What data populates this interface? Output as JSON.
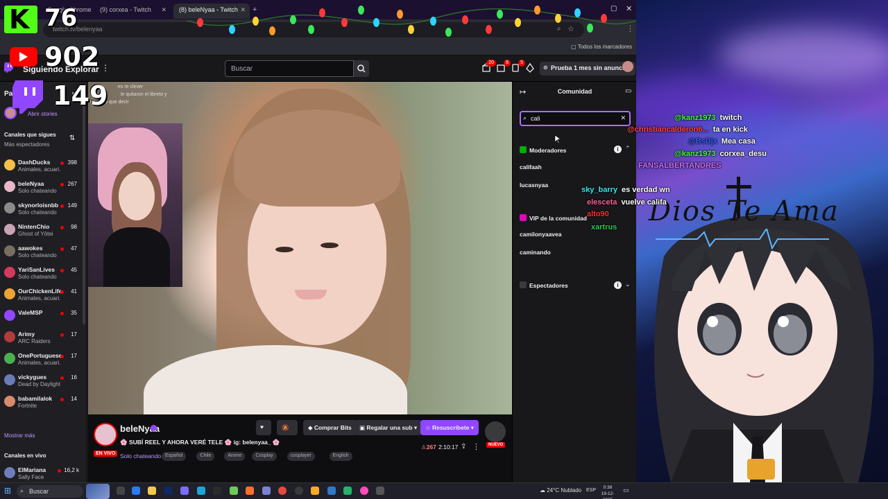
{
  "browser": {
    "tabs": [
      {
        "label": "Google Chrome"
      },
      {
        "label": "(9) corxea - Twitch"
      },
      {
        "label": "(8) beleNyaa - Twitch"
      }
    ],
    "url": "twitch.tv/belenyaa",
    "all_bookmarks": "Todos los marcadores"
  },
  "counters": {
    "kick": "76",
    "youtube": "902",
    "twitch": "149"
  },
  "nav": {
    "following": "Siguiendo",
    "explore": "Explorar",
    "search_placeholder": "Buscar",
    "notif_count_1": "20",
    "notif_count_2": "8",
    "notif_count_3": "5",
    "no_ads": "Prueba 1 mes sin anuncios"
  },
  "sidebar": {
    "header": "Para ti",
    "open_stories": "Abrir stories",
    "followed_title": "Canales que sigues",
    "followed_sub": "Más espectadores",
    "channels": [
      {
        "name": "DashDucks",
        "game": "Animales, acuari...",
        "viewers": "398",
        "color": "#f5c04a"
      },
      {
        "name": "beleNyaa",
        "game": "Solo chateando",
        "viewers": "267",
        "color": "#e8b7c8"
      },
      {
        "name": "skynorloisnbb",
        "game": "Solo chateando",
        "viewers": "149",
        "color": "#8b8b8b"
      },
      {
        "name": "NintenChio",
        "game": "Ghost of Yōtei",
        "viewers": "98",
        "color": "#c9a4b5"
      },
      {
        "name": "aawokes",
        "game": "Solo chateando",
        "viewers": "47",
        "color": "#7a6d62"
      },
      {
        "name": "YariSanLives",
        "game": "Solo chateando",
        "viewers": "45",
        "color": "#d23b5c"
      },
      {
        "name": "OurChickenLife",
        "game": "Animales, acuari...",
        "viewers": "41",
        "color": "#f0a235"
      },
      {
        "name": "ValeMSP",
        "game": "",
        "viewers": "35",
        "color": "#9147ff"
      },
      {
        "name": "Arimy",
        "game": "ARC Raiders",
        "viewers": "17",
        "color": "#b33b3b"
      },
      {
        "name": "OnePortuguese...",
        "game": "Animales, acuari...",
        "viewers": "17",
        "color": "#4caf50"
      },
      {
        "name": "vickygues",
        "game": "Dead by Daylight",
        "viewers": "16",
        "color": "#6b7bb5"
      },
      {
        "name": "babamilalok",
        "game": "Fortnite",
        "viewers": "14",
        "color": "#d88c6a"
      }
    ],
    "show_more": "Mostrar más",
    "live_title": "Canales en vivo",
    "live_channel": {
      "name": "ElMariana",
      "game": "Sally Face",
      "viewers": "16,2 k"
    }
  },
  "stream": {
    "streamer": "beleNyaa",
    "title": "🌸 SUBÍ REEL Y AHORA VERÉ TELE 🌸 ig: belenyaa_ 🌸",
    "category": "Solo chateando",
    "tags": [
      "Español",
      "Chile",
      "Anime",
      "Cosplay",
      "cosplayer",
      "English"
    ],
    "live_label": "EN VIVO",
    "viewers": "267",
    "uptime": "2:10:17",
    "buy_bits": "Comprar Bits",
    "gift_sub": "Regalar una sub",
    "resub": "Resuscríbete",
    "new_label": "NUEVO",
    "overlay_chat": [
      "es re clever",
      "le quitaron el libreto y",
      "no supo que decir"
    ]
  },
  "community": {
    "title": "Comunidad",
    "search_value": "cali",
    "moderators_label": "Moderadores",
    "moderators": [
      "califaah",
      "lucasnyaa"
    ],
    "vip_label": "VIP de la comunidad",
    "vips": [
      "camilonyaavea",
      "caminando"
    ],
    "viewers_label": "Espectadores"
  },
  "overlay_chat": [
    {
      "user": "@kanz1973",
      "msg": "twitch",
      "color": "#3cff3c"
    },
    {
      "user": "@christiancalderon6...",
      "msg": "ta en kick",
      "color": "#ff4444"
    },
    {
      "user": "@BsDjx",
      "msg": "Mea casa",
      "color": "#3b5cff"
    },
    {
      "user": "@kanz1973",
      "msg": "corxea_desu",
      "color": "#3cff3c"
    },
    {
      "user": "FANSALBERTANDRES",
      "msg": "",
      "color": "#c86bff"
    },
    {
      "user": "sky_barry",
      "msg": "es verdad wn",
      "color": "#3ce6e6"
    },
    {
      "user": "elesceta",
      "msg": "vuelve califa",
      "color": "#ff5b9a"
    },
    {
      "user": "alto90",
      "msg": "",
      "color": "#ff3030"
    },
    {
      "user": "xartrus",
      "msg": "",
      "color": "#29c94d"
    }
  ],
  "overlay_text": "Dios Te Ama",
  "taskbar": {
    "search": "Buscar",
    "weather": "24°C Nublado",
    "lang": "ESP",
    "time": "0:38",
    "date": "19-12-2025"
  }
}
